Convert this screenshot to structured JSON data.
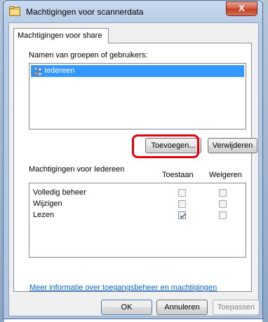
{
  "window": {
    "title": "Machtigingen voor scannerdata",
    "close_label": "X"
  },
  "tabs": [
    {
      "label": "Machtigingen voor share"
    }
  ],
  "groups": {
    "heading": "Namen van groepen of gebruikers:",
    "items": [
      {
        "label": "Iedereen",
        "icon": "users-icon",
        "selected": true
      }
    ],
    "add_button": "Toevoegen...",
    "remove_button": "Verwijderen"
  },
  "permissions": {
    "heading": "Machtigingen voor Iedereen",
    "col_allow": "Toestaan",
    "col_deny": "Weigeren",
    "rows": [
      {
        "label": "Volledig beheer",
        "allow": false,
        "deny": false
      },
      {
        "label": "Wijzigen",
        "allow": false,
        "deny": false
      },
      {
        "label": "Lezen",
        "allow": true,
        "deny": false
      }
    ]
  },
  "link": "Meer informatie over toegangsbeheer en machtigingen",
  "footer": {
    "ok": "OK",
    "cancel": "Annuleren",
    "apply": "Toepassen"
  },
  "colors": {
    "selection": "#3399ff",
    "highlight": "#e2000f",
    "link": "#0066cc"
  }
}
